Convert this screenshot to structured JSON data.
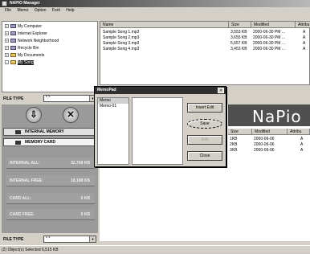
{
  "window": {
    "title": "NAPIO Manager"
  },
  "menu": [
    "File",
    "Memo",
    "Option",
    "Font",
    "Help"
  ],
  "tree": [
    {
      "label": "My Computer",
      "icon": "computer-icon"
    },
    {
      "label": "Internet Explorer",
      "icon": "globe-icon"
    },
    {
      "label": "Network Neighborhood",
      "icon": "network-icon"
    },
    {
      "label": "Recycle Bin",
      "icon": "recycle-bin-icon"
    },
    {
      "label": "My Documents",
      "icon": "folder-icon"
    },
    {
      "label": "My Song",
      "icon": "folder-icon"
    }
  ],
  "filelist": {
    "headers": [
      "Name",
      "Size",
      "Modified",
      "Attribu"
    ],
    "rows": [
      [
        "Sample Song 1.mp3",
        "3,553 KB",
        "2000-06-30 PM ...",
        "A"
      ],
      [
        "Sample Song 2.mp3",
        "3,655 KB",
        "2000-06-30 PM ...",
        "A"
      ],
      [
        "Sample Song 3.mp3",
        "5,657 KB",
        "2000-06-30 PM ...",
        "A"
      ],
      [
        "Sample Song 4.mp3",
        "3,453 KB",
        "2000-06-30 PM ...",
        "A"
      ]
    ]
  },
  "filetype": {
    "label": "FILE TYPE",
    "value": "*.*"
  },
  "device": {
    "internal_memory": "INTERNAL MEMORY",
    "memory_card": "MEMORY CARD",
    "stats": [
      {
        "label": "INTERNAL ALL:",
        "value": "32,768 KB"
      },
      {
        "label": "INTERNAL FREE:",
        "value": "18,188 KB"
      },
      {
        "label": "CARD ALL:",
        "value": "0 KB"
      },
      {
        "label": "CARD FREE:",
        "value": "0 KB"
      }
    ],
    "brand": "NaPio",
    "list": {
      "headers": [
        "Size",
        "Modified",
        "Attribu"
      ],
      "rows": [
        [
          "1KB",
          "2000-06-06",
          "A"
        ],
        [
          "2KB",
          "2000-06-06",
          "A"
        ],
        [
          "3KB",
          "2000-06-06",
          "A"
        ]
      ]
    }
  },
  "memopad": {
    "title": "MemoPad",
    "items": [
      "Memo",
      "Memo-01"
    ],
    "buttons": [
      "Insert Edit",
      "Save",
      "Edit",
      "Close"
    ]
  },
  "status": "(2) Object(s) Selected   6,515 KB"
}
